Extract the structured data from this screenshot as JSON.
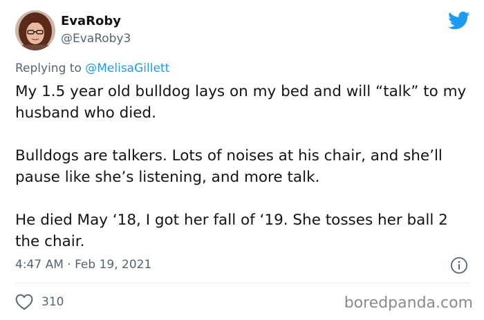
{
  "author": {
    "display_name": "EvaRoby",
    "handle": "@EvaRoby3",
    "avatar_icon": "profile-photo"
  },
  "reply": {
    "prefix": "Replying to ",
    "mention": "@MelisaGillett"
  },
  "tweet": {
    "paragraphs": [
      "My 1.5 year old bulldog lays on my bed and will “talk” to my husband who died.",
      "Bulldogs are talkers. Lots of noises at his chair, and she’ll pause like she’s listening, and more talk.",
      "He died May ‘18, I got her fall of ‘19. She tosses her ball 2 the chair."
    ],
    "timestamp": "4:47 AM · Feb 19, 2021"
  },
  "actions": {
    "like_count": "310"
  },
  "icons": {
    "brand": "twitter-bird-icon",
    "info": "info-icon",
    "like": "heart-icon"
  },
  "colors": {
    "twitter_blue": "#1d9bf0",
    "secondary_text": "#536471",
    "primary_text": "#0f1419"
  },
  "watermark": "boredpanda.com"
}
